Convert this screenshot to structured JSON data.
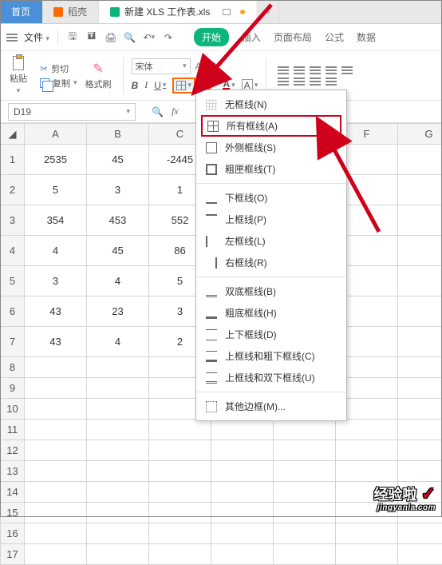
{
  "tabs": {
    "home": "首页",
    "daoke": "稻壳",
    "doc": "新建 XLS 工作表.xls",
    "plus": "+"
  },
  "menubar": {
    "file": "文件",
    "start": "开始",
    "insert": "插入",
    "layout": "页面布局",
    "formula": "公式",
    "data": "数据"
  },
  "ribbon": {
    "cut": "剪切",
    "copy": "复制",
    "paste": "粘贴",
    "format_painter": "格式刷",
    "font_name": "宋体",
    "bold": "B",
    "italic": "I",
    "underline": "U",
    "a_plus": "A⁺",
    "a_minus": "A⁻",
    "a_color": "A",
    "a_highlight": "A"
  },
  "fxrow": {
    "namebox": "D19",
    "fx": "fx"
  },
  "sheet": {
    "cols": [
      "A",
      "B",
      "C",
      "",
      "",
      "F",
      "G"
    ],
    "rows": [
      {
        "n": "1",
        "cells": [
          "2535",
          "45",
          "-2445",
          "",
          "",
          "",
          ""
        ]
      },
      {
        "n": "2",
        "cells": [
          "5",
          "3",
          "1",
          "",
          "",
          "",
          ""
        ]
      },
      {
        "n": "3",
        "cells": [
          "354",
          "453",
          "552",
          "",
          "",
          "",
          ""
        ]
      },
      {
        "n": "4",
        "cells": [
          "4",
          "45",
          "86",
          "",
          "",
          "",
          ""
        ]
      },
      {
        "n": "5",
        "cells": [
          "3",
          "4",
          "5",
          "",
          "",
          "",
          ""
        ]
      },
      {
        "n": "6",
        "cells": [
          "43",
          "23",
          "3",
          "",
          "",
          "",
          ""
        ]
      },
      {
        "n": "7",
        "cells": [
          "43",
          "4",
          "2",
          "",
          "",
          "",
          ""
        ]
      }
    ],
    "empty_rows": [
      "8",
      "9",
      "10",
      "11",
      "12",
      "13",
      "14",
      "15",
      "16",
      "17"
    ]
  },
  "border_menu": {
    "none": "无框线(N)",
    "all": "所有框线(A)",
    "outside": "外侧框线(S)",
    "thick": "粗匣框线(T)",
    "bottom": "下框线(O)",
    "top": "上框线(P)",
    "left": "左框线(L)",
    "right": "右框线(R)",
    "dbl_bottom": "双底框线(B)",
    "thick_bottom": "粗底框线(H)",
    "top_bottom": "上下框线(D)",
    "top_thick_bottom": "上框线和粗下框线(C)",
    "top_dbl_bottom": "上框线和双下框线(U)",
    "other": "其他边框(M)..."
  },
  "watermark": {
    "line1": "经验啦",
    "check": "✓",
    "line2": "jingyanla.com"
  }
}
